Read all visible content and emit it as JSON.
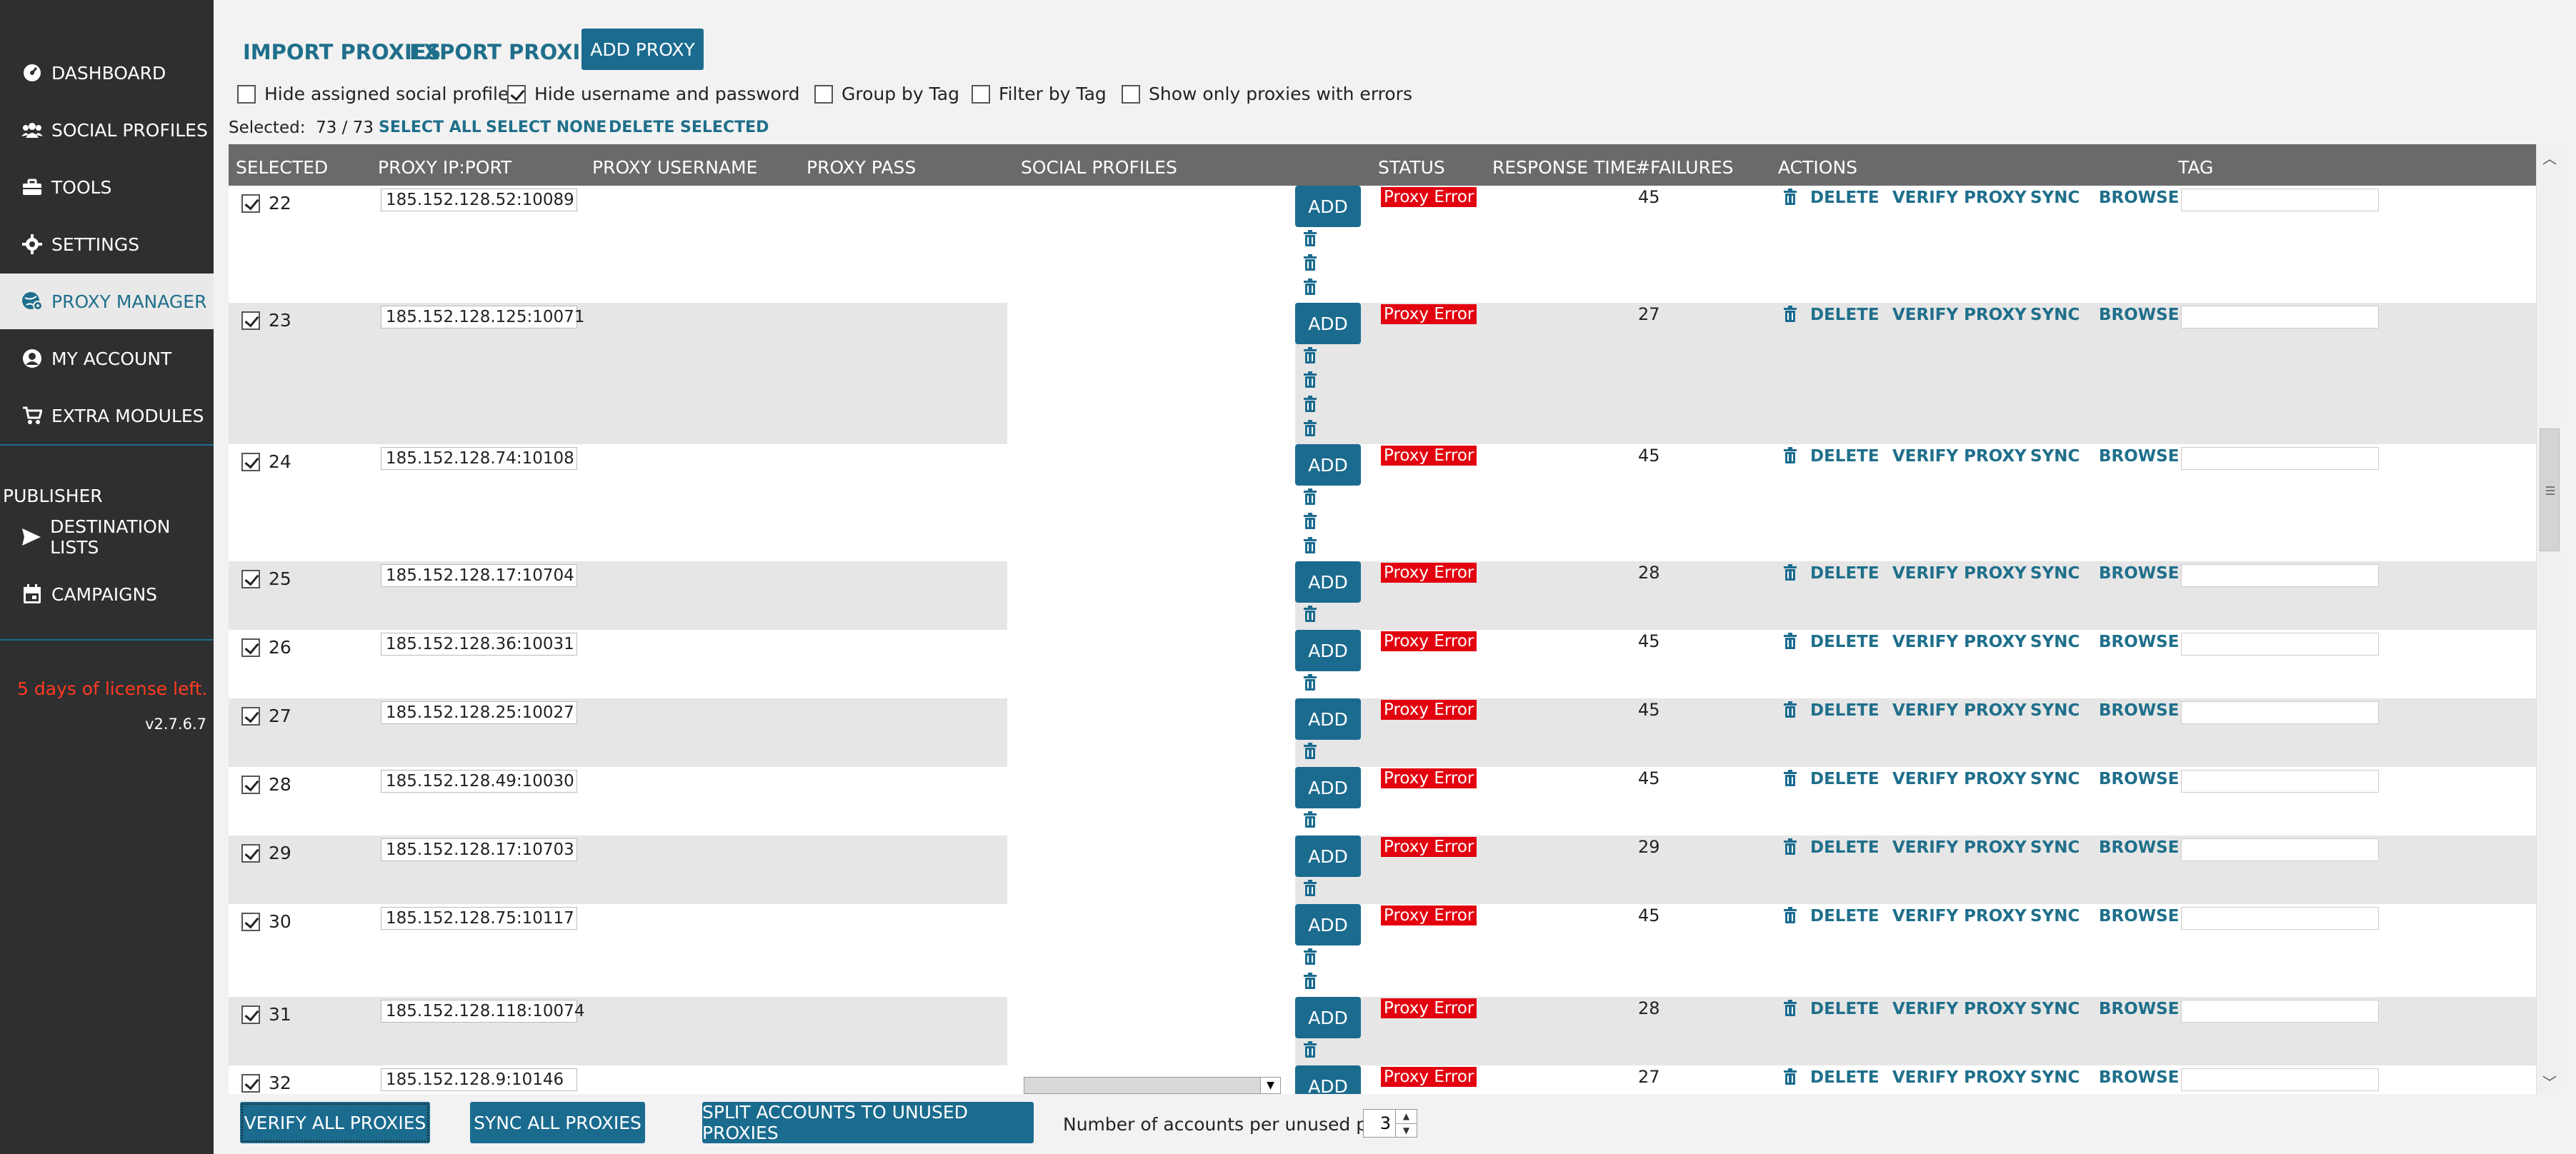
{
  "sidebar": {
    "items": [
      {
        "label": "DASHBOARD",
        "icon": "dashboard-icon",
        "active": false
      },
      {
        "label": "SOCIAL PROFILES",
        "icon": "users-icon",
        "active": false
      },
      {
        "label": "TOOLS",
        "icon": "toolbox-icon",
        "active": false
      },
      {
        "label": "SETTINGS",
        "icon": "gear-icon",
        "active": false
      },
      {
        "label": "PROXY MANAGER",
        "icon": "globe-gear-icon",
        "active": true
      },
      {
        "label": "MY ACCOUNT",
        "icon": "account-icon",
        "active": false
      },
      {
        "label": "EXTRA MODULES",
        "icon": "cart-icon",
        "active": false
      }
    ],
    "publisher_header": "PUBLISHER",
    "publisher_items": [
      {
        "label": "DESTINATION LISTS",
        "icon": "send-icon"
      },
      {
        "label": "CAMPAIGNS",
        "icon": "calendar-icon"
      }
    ],
    "license_text": "5 days of license left.",
    "version": "v2.7.6.7"
  },
  "toolbar": {
    "import_label": "IMPORT PROXIES",
    "export_label": "EXPORT PROXIES",
    "add_proxy_label": "ADD PROXY"
  },
  "filters": {
    "hide_assigned": {
      "label": "Hide assigned social profiles",
      "checked": false
    },
    "hide_credentials": {
      "label": "Hide username and password",
      "checked": true
    },
    "group_by_tag": {
      "label": "Group by Tag",
      "checked": false
    },
    "filter_by_tag": {
      "label": "Filter by Tag",
      "checked": false
    },
    "only_errors": {
      "label": "Show only proxies with errors",
      "checked": false
    }
  },
  "selection": {
    "label": "Selected:",
    "count": "73 / 73",
    "select_all": "SELECT ALL",
    "select_none": "SELECT NONE",
    "delete_selected": "DELETE SELECTED"
  },
  "table": {
    "columns": {
      "selected": "SELECTED",
      "ip_port": "PROXY IP:PORT",
      "username": "PROXY USERNAME",
      "pass": "PROXY PASS",
      "social": "SOCIAL PROFILES",
      "status": "STATUS",
      "response": "RESPONSE TIME",
      "failures": "#FAILURES",
      "actions": "ACTIONS",
      "tag": "TAG"
    },
    "add_label": "ADD",
    "status_label": "Proxy Error",
    "action_labels": {
      "delete": "DELETE",
      "verify": "VERIFY PROXY",
      "sync": "SYNC",
      "browse": "BROWSE"
    },
    "rows": [
      {
        "num": "22",
        "ip": "185.152.128.52:10089",
        "failures": "45",
        "trash_count": 3,
        "checked": true
      },
      {
        "num": "23",
        "ip": "185.152.128.125:10071",
        "failures": "27",
        "trash_count": 4,
        "checked": true
      },
      {
        "num": "24",
        "ip": "185.152.128.74:10108",
        "failures": "45",
        "trash_count": 3,
        "checked": true
      },
      {
        "num": "25",
        "ip": "185.152.128.17:10704",
        "failures": "28",
        "trash_count": 1,
        "checked": true
      },
      {
        "num": "26",
        "ip": "185.152.128.36:10031",
        "failures": "45",
        "trash_count": 1,
        "checked": true
      },
      {
        "num": "27",
        "ip": "185.152.128.25:10027",
        "failures": "45",
        "trash_count": 1,
        "checked": true
      },
      {
        "num": "28",
        "ip": "185.152.128.49:10030",
        "failures": "45",
        "trash_count": 1,
        "checked": true
      },
      {
        "num": "29",
        "ip": "185.152.128.17:10703",
        "failures": "29",
        "trash_count": 1,
        "checked": true
      },
      {
        "num": "30",
        "ip": "185.152.128.75:10117",
        "failures": "45",
        "trash_count": 2,
        "checked": true
      },
      {
        "num": "31",
        "ip": "185.152.128.118:10074",
        "failures": "28",
        "trash_count": 1,
        "checked": true
      },
      {
        "num": "32",
        "ip": "185.152.128.9:10146",
        "failures": "27",
        "trash_count": 0,
        "checked": true
      }
    ]
  },
  "bottom": {
    "verify_all": "VERIFY ALL PROXIES",
    "sync_all": "SYNC ALL PROXIES",
    "split_accounts": "SPLIT ACCOUNTS TO UNUSED PROXIES",
    "accounts_label": "Number of accounts per unused proxy",
    "accounts_value": "3"
  },
  "colors": {
    "sidebar_bg": "#2d2f31",
    "accent": "#1b6b8f",
    "error": "#e3000f",
    "license": "#ff3b1f"
  }
}
